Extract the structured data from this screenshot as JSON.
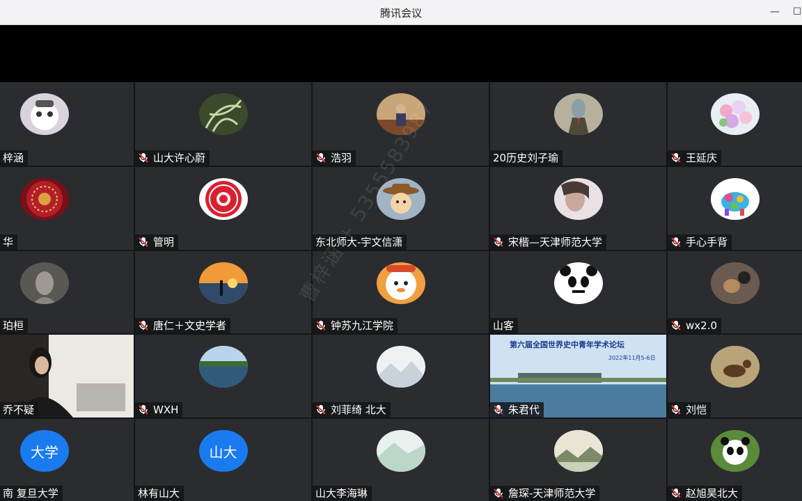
{
  "window": {
    "title": "腾讯会议"
  },
  "watermark": "曹梓涵 + 5355583987",
  "tiles": [
    {
      "name": "梓涵",
      "mic": false,
      "avatar": "cartoon-bear"
    },
    {
      "name": "山大许心蔚",
      "mic": true,
      "avatar": "plant"
    },
    {
      "name": "浩羽",
      "mic": true,
      "avatar": "person-photo"
    },
    {
      "name": "20历史刘子瑜",
      "mic": false,
      "avatar": "fish-suit"
    },
    {
      "name": "王延庆",
      "mic": true,
      "avatar": "flowers"
    },
    {
      "name": "华",
      "mic": false,
      "avatar": "red-pattern"
    },
    {
      "name": "管明",
      "mic": true,
      "avatar": "red-seal"
    },
    {
      "name": "东北师大-宇文信潇",
      "mic": false,
      "avatar": "cowboy-cartoon"
    },
    {
      "name": "宋楷—天津师范大学",
      "mic": true,
      "avatar": "portrait"
    },
    {
      "name": "手心手背",
      "mic": true,
      "avatar": "elephant"
    },
    {
      "name": "珀桓",
      "mic": false,
      "avatar": "statue"
    },
    {
      "name": "唐仁＋文史学者",
      "mic": true,
      "avatar": "sunset"
    },
    {
      "name": "钟苏九江学院",
      "mic": true,
      "avatar": "orange-cartoon"
    },
    {
      "name": "山客",
      "mic": false,
      "avatar": "panda-meme"
    },
    {
      "name": "wx2.0",
      "mic": true,
      "avatar": "deer"
    },
    {
      "name": "乔不疑",
      "mic": false,
      "avatar": "video"
    },
    {
      "name": "WXH",
      "mic": true,
      "avatar": "lake"
    },
    {
      "name": "刘菲绮  北大",
      "mic": true,
      "avatar": "mountain"
    },
    {
      "name": "朱君代",
      "mic": true,
      "avatar": "conference-banner"
    },
    {
      "name": "刘恺",
      "mic": true,
      "avatar": "horse-painting"
    },
    {
      "name": "南 复旦大学",
      "mic": false,
      "avatar": "text",
      "avatar_text": "大学"
    },
    {
      "name": "林有山大",
      "mic": false,
      "avatar": "text",
      "avatar_text": "山大"
    },
    {
      "name": "山大李海琳",
      "mic": false,
      "avatar": "landscape"
    },
    {
      "name": "詹琛-天津师范大学",
      "mic": true,
      "avatar": "ink-landscape"
    },
    {
      "name": "赵旭昊北大",
      "mic": true,
      "avatar": "panda"
    }
  ],
  "conference_banner": {
    "title": "第六届全国世界史中青年学术论坛",
    "date": "2022年11月5-6日"
  },
  "colors": {
    "accent_blue": "#1a7bf0",
    "mic_red": "#e03b3b"
  }
}
